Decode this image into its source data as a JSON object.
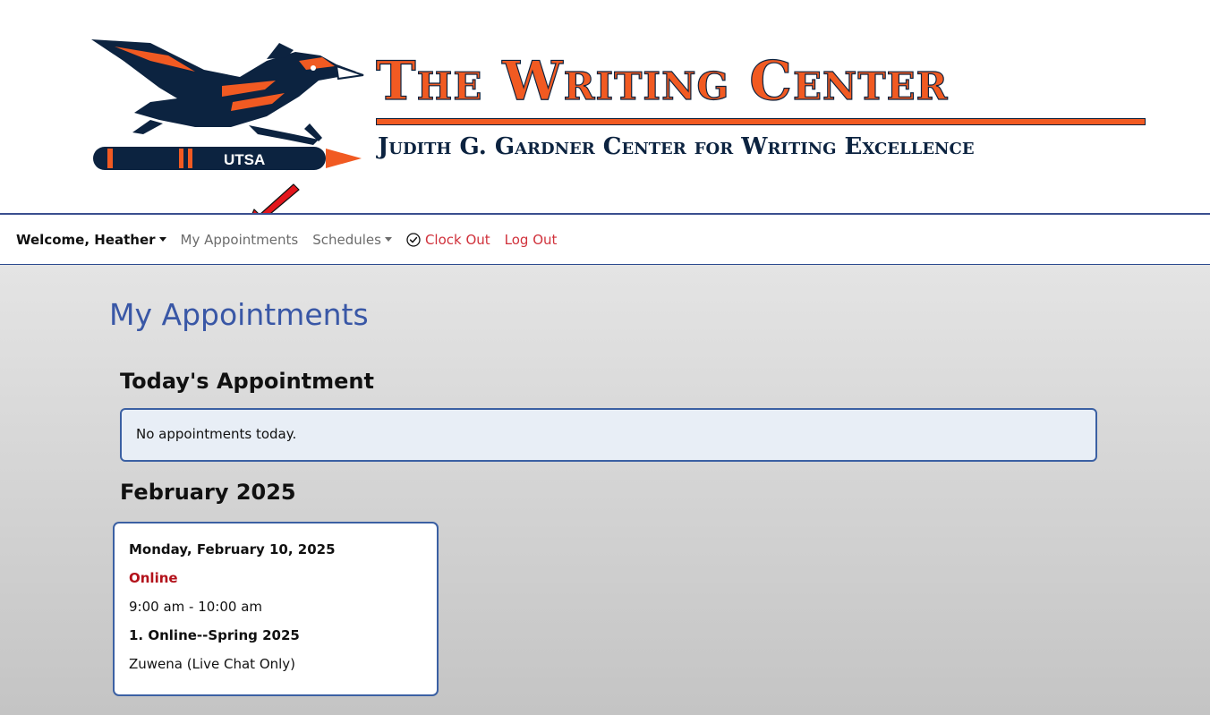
{
  "banner": {
    "title": "The Writing Center",
    "subtitle": "Judith G. Gardner Center for Writing Excellence",
    "logo_text": "UTSA"
  },
  "nav": {
    "welcome": "Welcome, Heather",
    "my_appointments": "My Appointments",
    "schedules": "Schedules",
    "clock_out": "Clock Out",
    "log_out": "Log Out"
  },
  "main": {
    "page_title": "My Appointments",
    "today_heading": "Today's Appointment",
    "today_message": "No appointments today.",
    "month_heading": "February 2025",
    "appointments": [
      {
        "date": "Monday, February 10, 2025",
        "location": "Online",
        "time": "9:00 am - 10:00 am",
        "schedule": "1. Online--Spring 2025",
        "consultant": "Zuwena (Live Chat Only)"
      }
    ]
  },
  "colors": {
    "orange": "#f15a22",
    "navy": "#0c2340",
    "link_blue": "#3957a6",
    "danger_red": "#d0313b",
    "location_red": "#b3121b",
    "annotation_arrow": "#e3161c"
  },
  "icons": [
    "roadrunner-pen-logo",
    "check-circle-icon",
    "caret-down-icon",
    "red-arrow-annotation"
  ]
}
